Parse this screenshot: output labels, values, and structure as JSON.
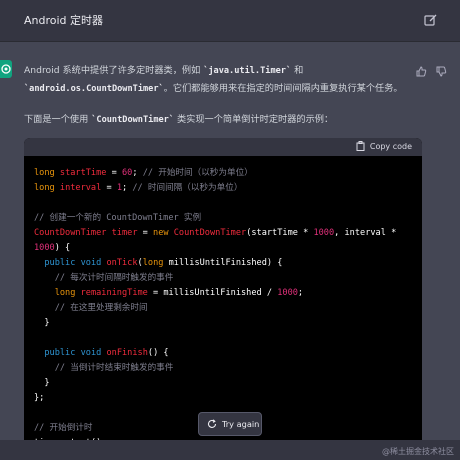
{
  "header": {
    "title": "Android 定时器"
  },
  "message": {
    "p1_a": "Android 系统中提供了许多定时器类，例如 ",
    "p1_code1": "`java.util.Timer`",
    "p1_b": " 和",
    "p1_code2": "`android.os.CountDownTimer`",
    "p1_c": "。它们都能够用来在指定的时间间隔内重复执行某个任务。",
    "p2_a": "下面是一个使用 ",
    "p2_code": "`CountDownTimer`",
    "p2_b": " 类实现一个简单倒计时定时器的示例："
  },
  "codeblock": {
    "copy_label": "Copy code"
  },
  "try_again": "Try again",
  "watermark": "@稀土掘金技术社区",
  "colors": {
    "header_bg": "#343541",
    "row_bg": "#444654",
    "avatar": "#10a37f"
  },
  "icons": [
    "edit-icon",
    "openai-logo-icon",
    "thumbs-up-icon",
    "thumbs-down-icon",
    "clipboard-icon",
    "refresh-icon"
  ]
}
